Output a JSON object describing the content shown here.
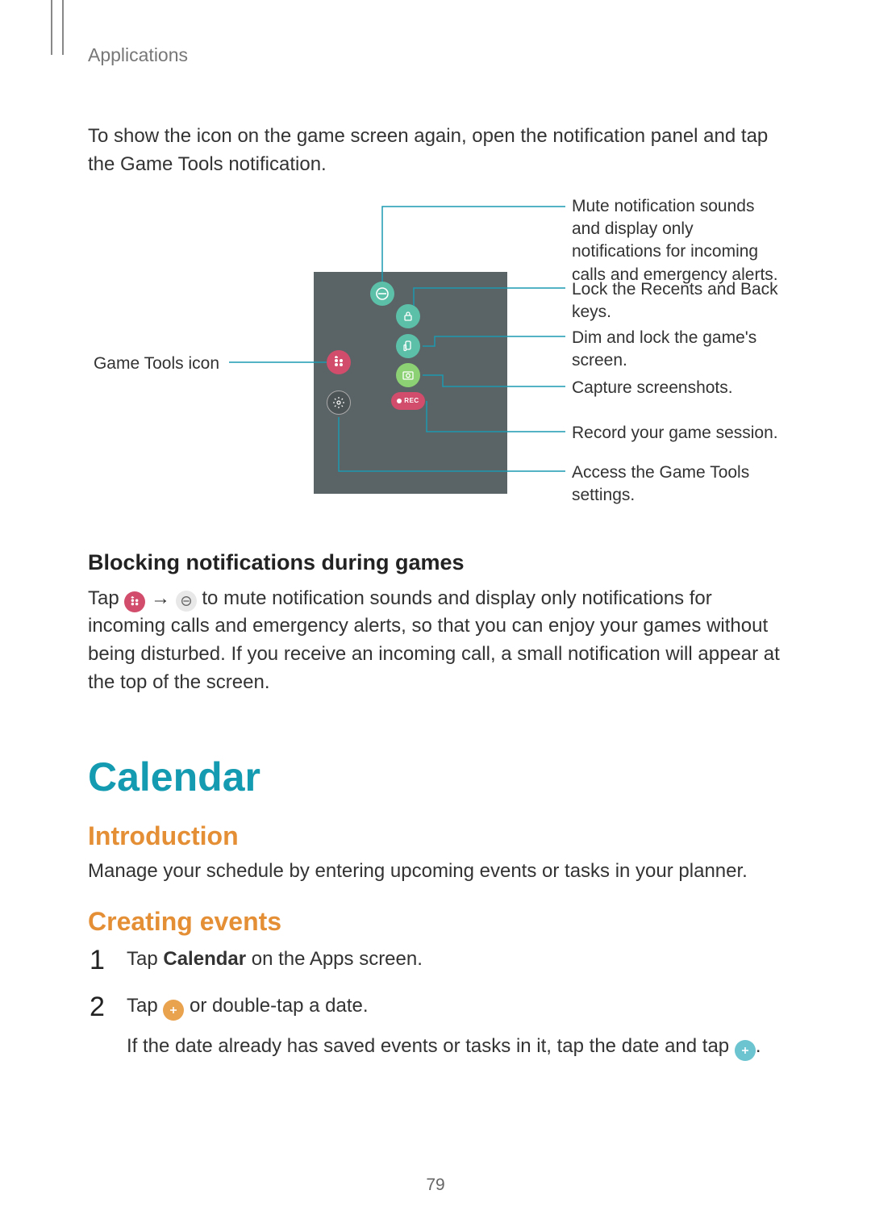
{
  "breadcrumb": "Applications",
  "intro_paragraph": "To show the icon on the game screen again, open the notification panel and tap the Game Tools notification.",
  "diagram": {
    "left_label": "Game Tools icon",
    "callouts": {
      "mute": "Mute notification sounds and display only notifications for incoming calls and emergency alerts.",
      "lock": "Lock the Recents and Back keys.",
      "dim": "Dim and lock the game's screen.",
      "capture": "Capture screenshots.",
      "record": "Record your game session.",
      "settings": "Access the Game Tools settings."
    },
    "icons": {
      "game_tools": "game-tools-icon",
      "mute": "mute-icon",
      "lock": "lock-icon",
      "dim": "dim-icon",
      "capture": "capture-icon",
      "record": "record-icon",
      "record_label": "REC",
      "settings": "settings-icon"
    }
  },
  "blocking": {
    "heading": "Blocking notifications during games",
    "sentence_parts": {
      "p1": "Tap ",
      "arrow": " → ",
      "p2": " to mute notification sounds and display only notifications for incoming calls and emergency alerts, so that you can enjoy your games without being disturbed. If you receive an incoming call, a small notification will appear at the top of the screen."
    }
  },
  "calendar": {
    "title": "Calendar",
    "introduction_heading": "Introduction",
    "introduction_text": "Manage your schedule by entering upcoming events or tasks in your planner.",
    "creating_heading": "Creating events",
    "steps": {
      "s1_a": "Tap ",
      "s1_b": "Calendar",
      "s1_c": " on the Apps screen.",
      "s2_a": "Tap ",
      "s2_b": " or double-tap a date.",
      "s2_note_a": "If the date already has saved events or tasks in it, tap the date and tap ",
      "s2_note_b": "."
    },
    "numbers": {
      "one": "1",
      "two": "2"
    }
  },
  "page_number": "79"
}
